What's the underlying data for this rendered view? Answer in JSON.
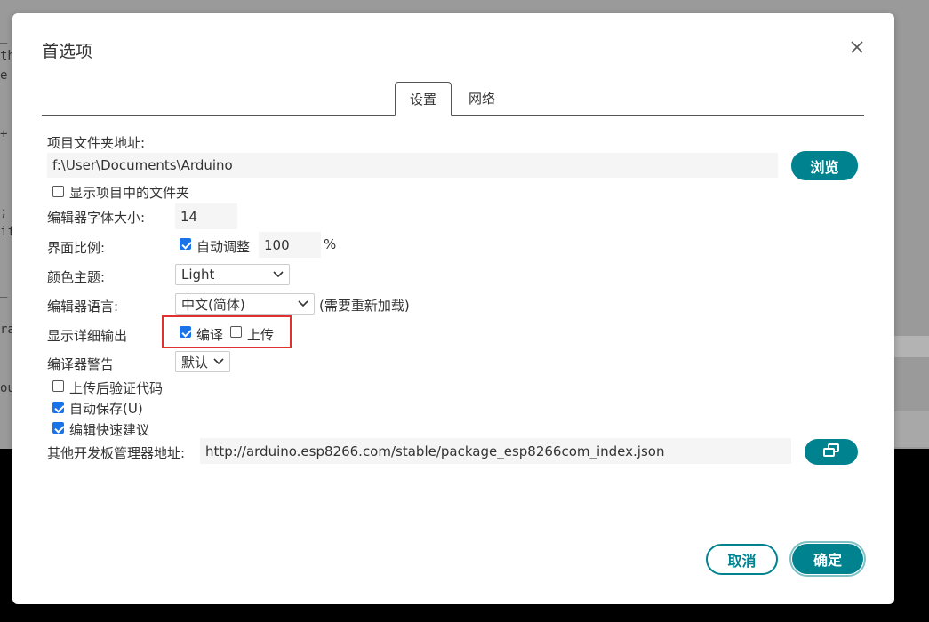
{
  "background": {
    "code_fragments": [
      "_",
      "th",
      "e",
      "",
      "",
      "+",
      "",
      "",
      "",
      ";",
      "if",
      "",
      "",
      "_",
      "",
      "ra",
      "",
      "",
      "ou"
    ]
  },
  "dialog": {
    "title": "首选项",
    "tabs": [
      {
        "label": "设置",
        "active": true
      },
      {
        "label": "网络",
        "active": false
      }
    ],
    "sketchbook": {
      "label": "项目文件夹地址:",
      "value": "f:\\User\\Documents\\Arduino",
      "browse_label": "浏览"
    },
    "show_files": {
      "label": "显示项目中的文件夹",
      "checked": false
    },
    "font_size": {
      "label": "编辑器字体大小:",
      "value": "14"
    },
    "scale": {
      "label": "界面比例:",
      "auto_label": "自动调整",
      "auto_checked": true,
      "value": "100",
      "unit": "%"
    },
    "theme": {
      "label": "颜色主题:",
      "value": "Light"
    },
    "language": {
      "label": "编辑器语言:",
      "value": "中文(简体)",
      "note": "(需要重新加载)"
    },
    "verbose": {
      "label": "显示详细输出",
      "compile_label": "编译",
      "compile_checked": true,
      "upload_label": "上传",
      "upload_checked": false
    },
    "warnings": {
      "label": "编译器警告",
      "value": "默认"
    },
    "verify_upload": {
      "label": "上传后验证代码",
      "checked": false
    },
    "auto_save": {
      "label": "自动保存(U)",
      "checked": true
    },
    "quick_suggestions": {
      "label": "编辑快速建议",
      "checked": true
    },
    "board_urls": {
      "label": "其他开发板管理器地址:",
      "value": "http://arduino.esp8266.com/stable/package_esp8266com_index.json"
    },
    "cancel_label": "取消",
    "ok_label": "确定"
  },
  "colors": {
    "accent": "#00838f",
    "checkbox": "#1a73e8",
    "highlight": "#e03030"
  }
}
